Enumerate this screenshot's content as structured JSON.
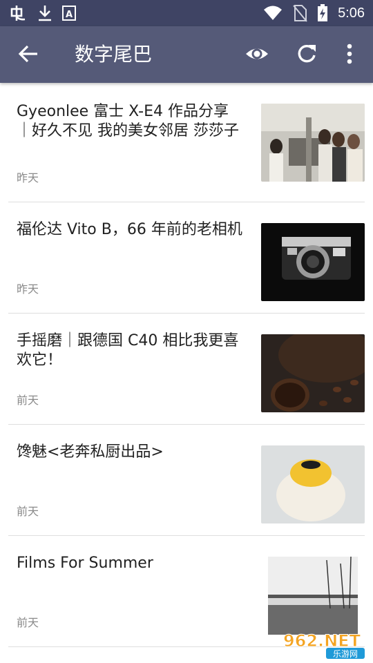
{
  "status_bar": {
    "left_icons": [
      "bug-icon",
      "download-icon",
      "font-a-icon"
    ],
    "right_icons": [
      "wifi-icon",
      "no-sim-icon",
      "battery-charging-icon"
    ],
    "time": "5:06"
  },
  "app_bar": {
    "title": "数字尾巴",
    "back_icon": "arrow-back-icon",
    "actions": [
      "eye-icon",
      "refresh-icon",
      "more-vert-icon"
    ]
  },
  "colors": {
    "status_bar_bg": "#3f4464",
    "app_bar_bg": "#555a78",
    "title_text": "#212121",
    "date_text": "#8a8a8a",
    "divider": "#dedede"
  },
  "articles": [
    {
      "title": "Gyeonlee 富士  X-E4 作品分享｜好久不见 我的美女邻居 莎莎子",
      "date": "昨天",
      "thumbnail": "photo-women-street"
    },
    {
      "title": "福伦达 Vito B，66 年前的老相机",
      "date": "昨天",
      "thumbnail": "photo-vintage-camera"
    },
    {
      "title": "手摇磨｜跟德国 C40 相比我更喜欢它！",
      "date": "前天",
      "thumbnail": "photo-coffee-beans"
    },
    {
      "title": "馋魅<老奔私厨出品>",
      "date": "前天",
      "thumbnail": "photo-pastry"
    },
    {
      "title": "Films For Summer",
      "date": "前天",
      "thumbnail": "photo-bw-harbor"
    }
  ],
  "watermark": {
    "text_top": "962.NET",
    "text_bottom": "乐游网"
  }
}
